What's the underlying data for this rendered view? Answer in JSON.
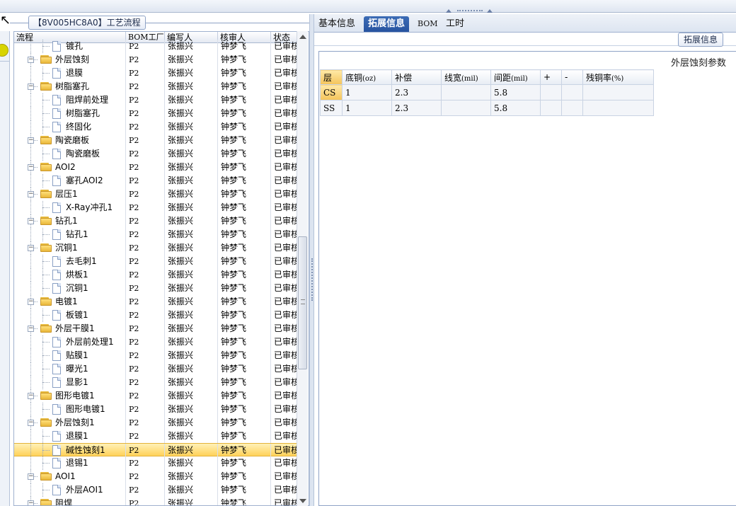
{
  "window": {
    "title_tag": "【8V005HC8A0】工艺流程"
  },
  "tree": {
    "columns": [
      "流程",
      "BOM工厂",
      "编写人",
      "核审人",
      "状态"
    ],
    "rows": [
      {
        "label": "镀孔",
        "level": 2,
        "type": "doc",
        "factory": "P2",
        "author": "张振兴",
        "reviewer": "钟梦飞",
        "status": "已审核"
      },
      {
        "label": "外层蚀刻",
        "level": 1,
        "type": "folder",
        "factory": "P2",
        "author": "张振兴",
        "reviewer": "钟梦飞",
        "status": "已审核"
      },
      {
        "label": "退膜",
        "level": 2,
        "type": "doc",
        "factory": "P2",
        "author": "张振兴",
        "reviewer": "钟梦飞",
        "status": "已审核"
      },
      {
        "label": "树脂塞孔",
        "level": 1,
        "type": "folder",
        "factory": "P2",
        "author": "张振兴",
        "reviewer": "钟梦飞",
        "status": "已审核"
      },
      {
        "label": "阻焊前处理",
        "level": 2,
        "type": "doc",
        "factory": "P2",
        "author": "张振兴",
        "reviewer": "钟梦飞",
        "status": "已审核"
      },
      {
        "label": "树脂塞孔",
        "level": 2,
        "type": "doc",
        "factory": "P2",
        "author": "张振兴",
        "reviewer": "钟梦飞",
        "status": "已审核"
      },
      {
        "label": "终固化",
        "level": 2,
        "type": "doc",
        "factory": "P2",
        "author": "张振兴",
        "reviewer": "钟梦飞",
        "status": "已审核"
      },
      {
        "label": "陶瓷磨板",
        "level": 1,
        "type": "folder",
        "factory": "P2",
        "author": "张振兴",
        "reviewer": "钟梦飞",
        "status": "已审核"
      },
      {
        "label": "陶瓷磨板",
        "level": 2,
        "type": "doc",
        "factory": "P2",
        "author": "张振兴",
        "reviewer": "钟梦飞",
        "status": "已审核"
      },
      {
        "label": "AOI2",
        "level": 1,
        "type": "folder",
        "factory": "P2",
        "author": "张振兴",
        "reviewer": "钟梦飞",
        "status": "已审核"
      },
      {
        "label": "塞孔AOI2",
        "level": 2,
        "type": "doc",
        "factory": "P2",
        "author": "张振兴",
        "reviewer": "钟梦飞",
        "status": "已审核"
      },
      {
        "label": "层压1",
        "level": 1,
        "type": "folder",
        "factory": "P2",
        "author": "张振兴",
        "reviewer": "钟梦飞",
        "status": "已审核"
      },
      {
        "label": "X-Ray冲孔1",
        "level": 2,
        "type": "doc",
        "factory": "P2",
        "author": "张振兴",
        "reviewer": "钟梦飞",
        "status": "已审核"
      },
      {
        "label": "钻孔1",
        "level": 1,
        "type": "folder",
        "factory": "P2",
        "author": "张振兴",
        "reviewer": "钟梦飞",
        "status": "已审核"
      },
      {
        "label": "钻孔1",
        "level": 2,
        "type": "doc",
        "factory": "P2",
        "author": "张振兴",
        "reviewer": "钟梦飞",
        "status": "已审核"
      },
      {
        "label": "沉铜1",
        "level": 1,
        "type": "folder",
        "factory": "P2",
        "author": "张振兴",
        "reviewer": "钟梦飞",
        "status": "已审核"
      },
      {
        "label": "去毛刺1",
        "level": 2,
        "type": "doc",
        "factory": "P2",
        "author": "张振兴",
        "reviewer": "钟梦飞",
        "status": "已审核"
      },
      {
        "label": "烘板1",
        "level": 2,
        "type": "doc",
        "factory": "P2",
        "author": "张振兴",
        "reviewer": "钟梦飞",
        "status": "已审核"
      },
      {
        "label": "沉铜1",
        "level": 2,
        "type": "doc",
        "factory": "P2",
        "author": "张振兴",
        "reviewer": "钟梦飞",
        "status": "已审核"
      },
      {
        "label": "电镀1",
        "level": 1,
        "type": "folder",
        "factory": "P2",
        "author": "张振兴",
        "reviewer": "钟梦飞",
        "status": "已审核"
      },
      {
        "label": "板镀1",
        "level": 2,
        "type": "doc",
        "factory": "P2",
        "author": "张振兴",
        "reviewer": "钟梦飞",
        "status": "已审核"
      },
      {
        "label": "外层干膜1",
        "level": 1,
        "type": "folder",
        "factory": "P2",
        "author": "张振兴",
        "reviewer": "钟梦飞",
        "status": "已审核"
      },
      {
        "label": "外层前处理1",
        "level": 2,
        "type": "doc",
        "factory": "P2",
        "author": "张振兴",
        "reviewer": "钟梦飞",
        "status": "已审核"
      },
      {
        "label": "贴膜1",
        "level": 2,
        "type": "doc",
        "factory": "P2",
        "author": "张振兴",
        "reviewer": "钟梦飞",
        "status": "已审核"
      },
      {
        "label": "曝光1",
        "level": 2,
        "type": "doc",
        "factory": "P2",
        "author": "张振兴",
        "reviewer": "钟梦飞",
        "status": "已审核"
      },
      {
        "label": "显影1",
        "level": 2,
        "type": "doc",
        "factory": "P2",
        "author": "张振兴",
        "reviewer": "钟梦飞",
        "status": "已审核"
      },
      {
        "label": "图形电镀1",
        "level": 1,
        "type": "folder",
        "factory": "P2",
        "author": "张振兴",
        "reviewer": "钟梦飞",
        "status": "已审核"
      },
      {
        "label": "图形电镀1",
        "level": 2,
        "type": "doc",
        "factory": "P2",
        "author": "张振兴",
        "reviewer": "钟梦飞",
        "status": "已审核"
      },
      {
        "label": "外层蚀刻1",
        "level": 1,
        "type": "folder",
        "factory": "P2",
        "author": "张振兴",
        "reviewer": "钟梦飞",
        "status": "已审核"
      },
      {
        "label": "退膜1",
        "level": 2,
        "type": "doc",
        "factory": "P2",
        "author": "张振兴",
        "reviewer": "钟梦飞",
        "status": "已审核"
      },
      {
        "label": "碱性蚀刻1",
        "level": 2,
        "type": "doc",
        "factory": "P2",
        "author": "张振兴",
        "reviewer": "钟梦飞",
        "status": "已审核",
        "selected": true
      },
      {
        "label": "退锡1",
        "level": 2,
        "type": "doc",
        "factory": "P2",
        "author": "张振兴",
        "reviewer": "钟梦飞",
        "status": "已审核"
      },
      {
        "label": "AOI1",
        "level": 1,
        "type": "folder",
        "factory": "P2",
        "author": "张振兴",
        "reviewer": "钟梦飞",
        "status": "已审核"
      },
      {
        "label": "外层AOI1",
        "level": 2,
        "type": "doc",
        "factory": "P2",
        "author": "张振兴",
        "reviewer": "钟梦飞",
        "status": "已审核"
      },
      {
        "label": "阻焊",
        "level": 1,
        "type": "folder",
        "factory": "P2",
        "author": "张振兴",
        "reviewer": "钟梦飞",
        "status": "已审核"
      }
    ]
  },
  "tabs": [
    {
      "label": "基本信息",
      "active": false
    },
    {
      "label": "拓展信息",
      "active": true
    },
    {
      "label": "BOM",
      "active": false
    },
    {
      "label": "工时",
      "active": false
    }
  ],
  "extended": {
    "button_label": "拓展信息",
    "grid_title": "外层蚀刻参数",
    "columns": [
      "层",
      "底铜",
      "(oz)",
      "补偿",
      "线宽",
      "(mil)",
      "间距",
      "(mil)",
      "+",
      "-",
      "残铜率",
      "(%)"
    ],
    "rows": [
      {
        "layer": "CS",
        "base_copper": "1",
        "compensation": "2.3",
        "line_width": "",
        "spacing": "5.8",
        "plus": "",
        "minus": "",
        "residual": ""
      },
      {
        "layer": "SS",
        "base_copper": "1",
        "compensation": "2.3",
        "line_width": "",
        "spacing": "5.8",
        "plus": "",
        "minus": "",
        "residual": ""
      }
    ]
  },
  "colors": {
    "selection": "#ffd25a",
    "tab_active": "#2753a0",
    "folder": "#e9b73a"
  }
}
